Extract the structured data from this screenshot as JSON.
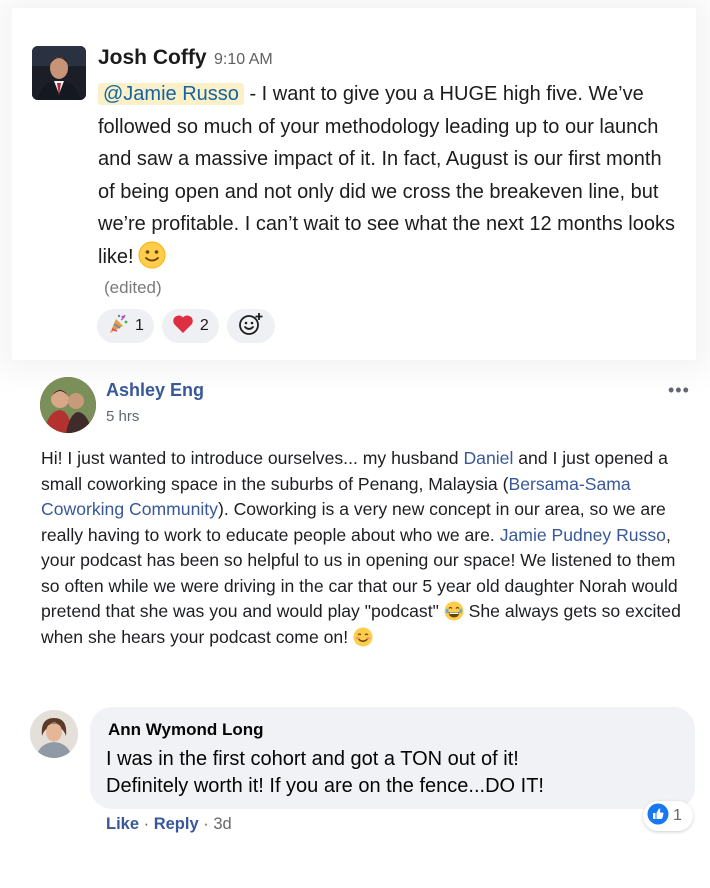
{
  "slack": {
    "author": "Josh Coffy",
    "time": "9:10 AM",
    "mention": "@Jamie Russo",
    "message": " - I want to give you a HUGE high five. We’ve followed so much of your methodology leading up to our launch and saw a massive impact of it. In fact, August is our first month of being open and not only did we cross the breakeven line, but we’re profitable. I can’t wait to see what the next 12 months looks like!",
    "edited_label": "(edited)",
    "reactions": [
      {
        "icon": "confetti-icon",
        "count": "1"
      },
      {
        "icon": "heart-icon",
        "count": "2"
      }
    ],
    "add_reaction_icon": "add-reaction-icon"
  },
  "post": {
    "author": "Ashley Eng",
    "time": "5 hrs",
    "more_icon": "more-options-icon",
    "t1": "Hi! I just wanted to introduce ourselves... my husband ",
    "link1": "Daniel",
    "t2": " and I just opened a small coworking space in the suburbs of Penang, Malaysia (",
    "link2": "Bersama-Sama Coworking Community",
    "t3": "). Coworking is a very new concept in our area, so we are really having to work to educate people about who we are. ",
    "link3": "Jamie Pudney Russo",
    "t4": ", your podcast has been so helpful to us in opening our space! We listened to them so often while we were driving in the car that our 5 year old daughter Norah would pretend that she was you and would play \"podcast\" ",
    "t5": " She always gets so excited when she hears your podcast come on! ",
    "emojis": [
      "laughing-emoji-icon",
      "blushing-emoji-icon"
    ]
  },
  "comment": {
    "author": "Ann Wymond Long",
    "line1": "I was in the first cohort and got a TON out of it!",
    "line2": "Definitely worth it! If you are on the fence...DO IT!",
    "reaction_count": "1",
    "like_label": "Like",
    "reply_label": "Reply",
    "separator": " · ",
    "time": "3d"
  },
  "colors": {
    "mention_bg": "#fbf0c8",
    "mention_text": "#1264a3",
    "fb_link": "#385898",
    "bubble": "#f0f2f5",
    "heart": "#dd2e44",
    "fb_like": "#1877f2"
  }
}
